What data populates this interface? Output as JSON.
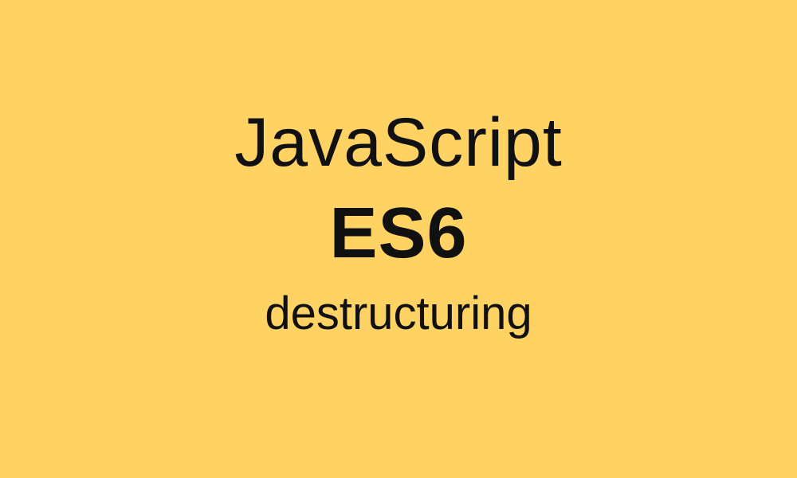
{
  "slide": {
    "title": "JavaScript",
    "version": "ES6",
    "subtitle": "destructuring"
  },
  "colors": {
    "background": "#ffd264",
    "text": "#111111"
  }
}
